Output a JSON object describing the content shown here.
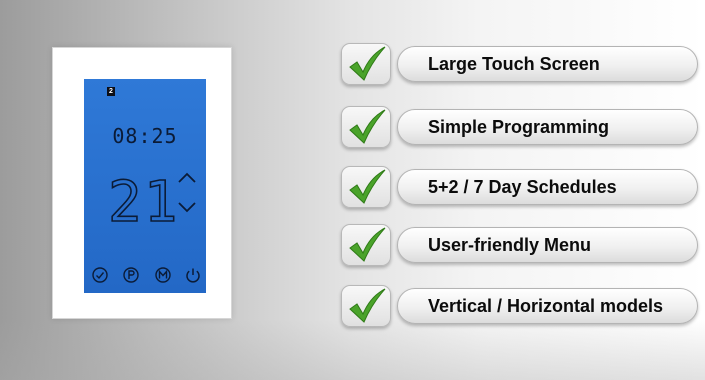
{
  "thermostat": {
    "day_indicator": "2",
    "time": "08:25",
    "temperature": "21",
    "buttons": [
      "confirm-icon",
      "program-icon",
      "menu-icon",
      "power-icon"
    ],
    "screen_color": "#2d75d3"
  },
  "features": [
    {
      "label": "Large Touch Screen"
    },
    {
      "label": "Simple Programming"
    },
    {
      "label": "5+2 / 7 Day Schedules"
    },
    {
      "label": "User-friendly Menu"
    },
    {
      "label": "Vertical / Horizontal models"
    }
  ],
  "colors": {
    "check_green": "#4aa32a",
    "lcd_segment": "#0b1b36"
  }
}
